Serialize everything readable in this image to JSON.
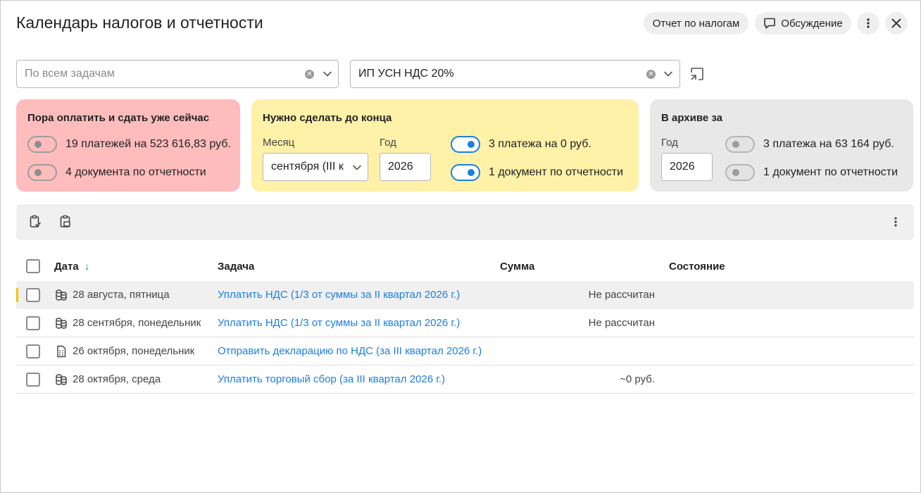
{
  "header": {
    "title": "Календарь налогов и отчетности",
    "report_btn": "Отчет по налогам",
    "discuss_btn": "Обсуждение"
  },
  "filters": {
    "task_filter_placeholder": "По всем задачам",
    "org_filter_value": "ИП УСН НДС 20%"
  },
  "cards": {
    "pay_now": {
      "title": "Пора оплатить и сдать уже сейчас",
      "payments": "19 платежей на 523 616,83 руб.",
      "documents": "4 документа по отчетности",
      "payments_on": false,
      "documents_on": false
    },
    "todo": {
      "title": "Нужно сделать до конца",
      "month_label": "Месяц",
      "month_value": "сентября (III к",
      "year_label": "Год",
      "year_value": "2026",
      "payments": "3 платежа на 0 руб.",
      "documents": "1 документ по отчетности",
      "payments_on": true,
      "documents_on": true
    },
    "archive": {
      "title": "В архиве за",
      "year_label": "Год",
      "year_value": "2026",
      "payments": "3 платежа на 63 164 руб.",
      "documents": "1 документ по отчетности",
      "payments_on": false,
      "documents_on": false
    }
  },
  "table": {
    "headers": {
      "date": "Дата",
      "task": "Задача",
      "sum": "Сумма",
      "state": "Состояние"
    },
    "sort_arrow": "↓",
    "rows": [
      {
        "icon": "coins-icon",
        "date": "28 августа, пятница",
        "task": "Уплатить НДС (1/3 от суммы за II квартал 2026 г.)",
        "sum": "Не рассчитан",
        "state": "",
        "highlighted": true
      },
      {
        "icon": "coins-icon",
        "date": "28 сентября, понедельник",
        "task": "Уплатить НДС (1/3 от суммы за II квартал 2026 г.)",
        "sum": "Не рассчитан",
        "state": "",
        "highlighted": false
      },
      {
        "icon": "document-icon",
        "date": "26 октября, понедельник",
        "task": "Отправить декларацию по НДС (за III квартал 2026 г.)",
        "sum": "",
        "state": "",
        "highlighted": false
      },
      {
        "icon": "coins-icon",
        "date": "28 октября, среда",
        "task": "Уплатить торговый сбор (за III квартал 2026 г.)",
        "sum": "~0 руб.",
        "state": "",
        "highlighted": false
      }
    ]
  },
  "colors": {
    "accent": "#1b7fe0",
    "red_card": "#ffbcbc",
    "yellow_card": "#fff1a8",
    "gray_card": "#e8e8e8",
    "row_marker": "#f5c400"
  }
}
